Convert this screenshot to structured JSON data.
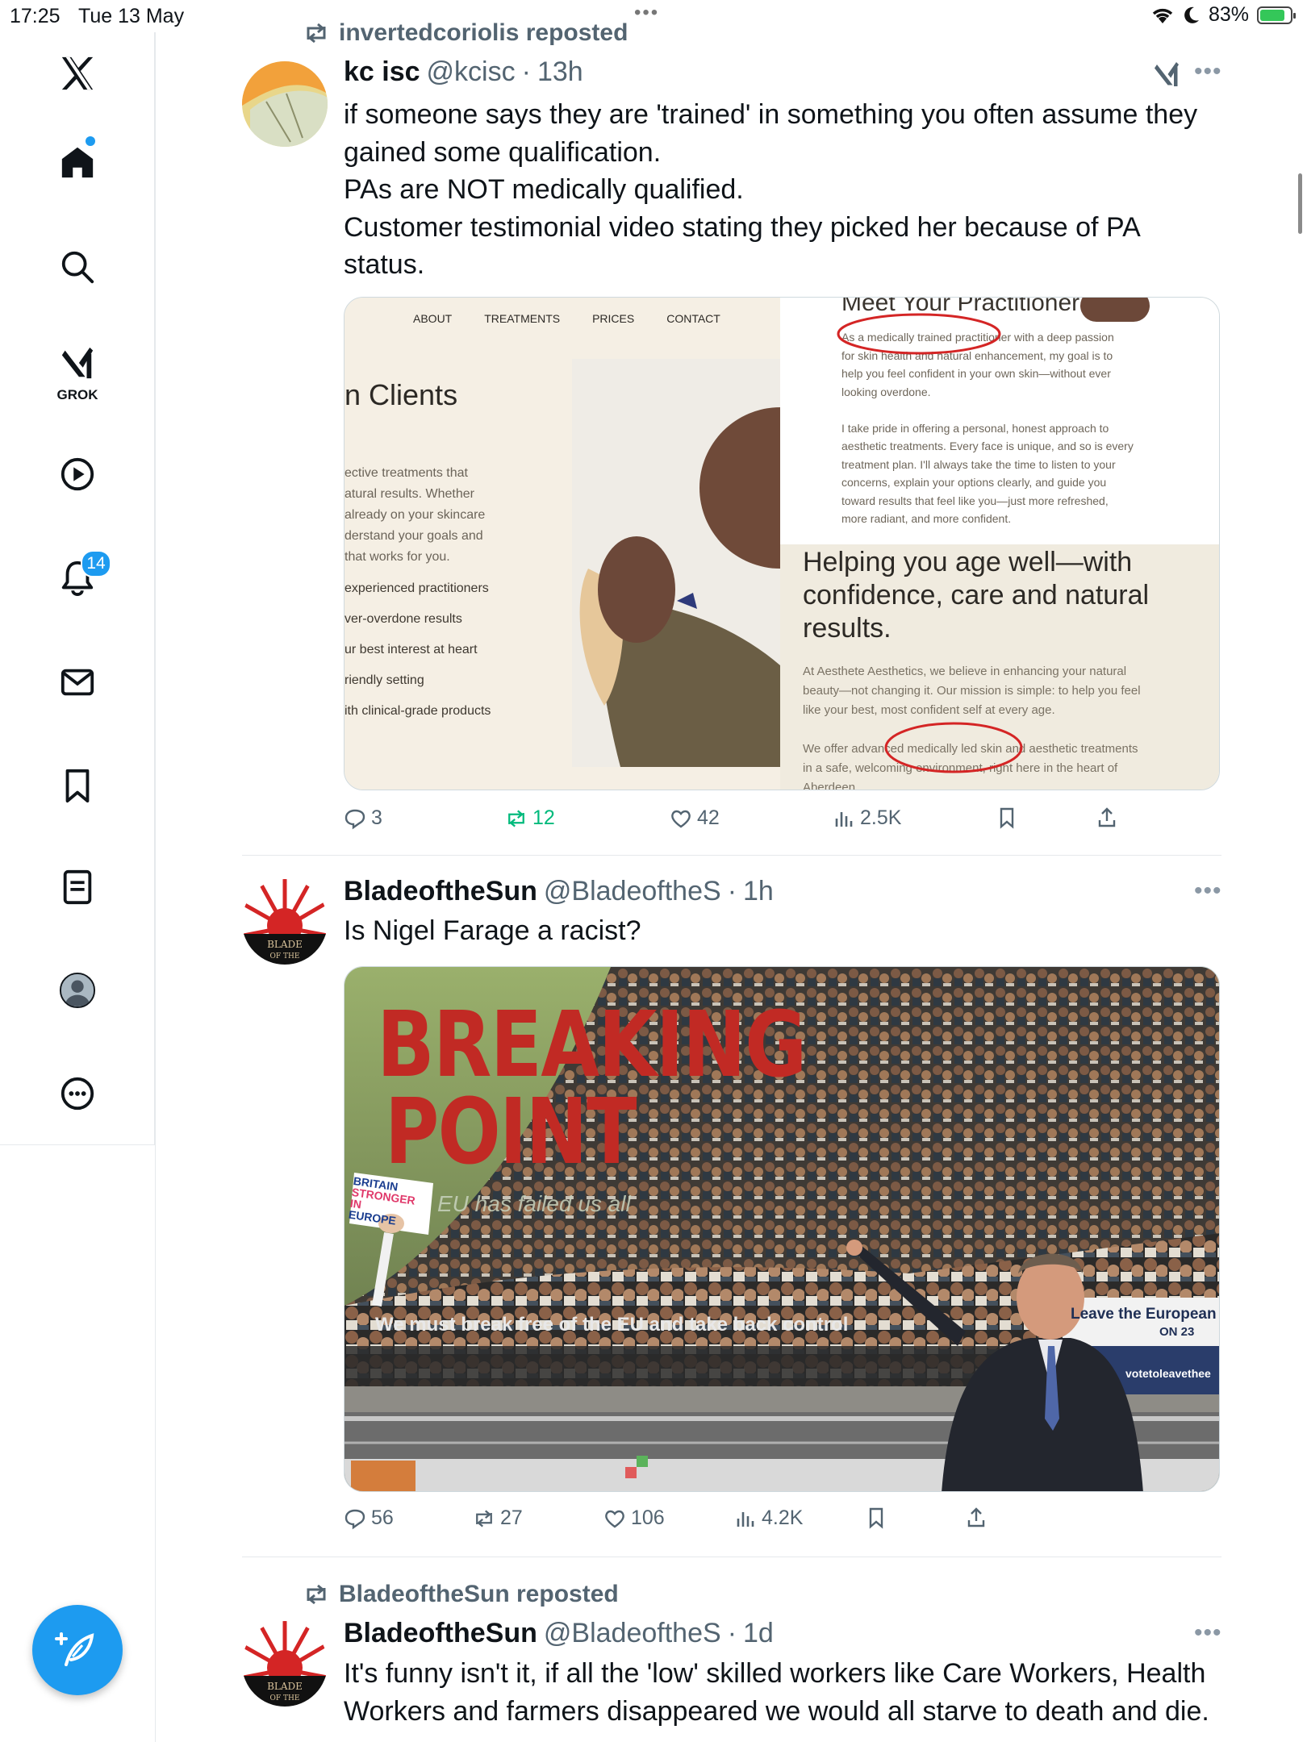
{
  "status_bar": {
    "time": "17:25",
    "date": "Tue 13 May",
    "battery": "83%"
  },
  "sidebar": {
    "items": [
      {
        "name": "x-logo",
        "label": ""
      },
      {
        "name": "home",
        "label": ""
      },
      {
        "name": "explore",
        "label": ""
      },
      {
        "name": "grok",
        "label": "GROK"
      },
      {
        "name": "video",
        "label": ""
      },
      {
        "name": "notifications",
        "label": "",
        "badge": "14"
      },
      {
        "name": "messages",
        "label": ""
      },
      {
        "name": "bookmarks",
        "label": ""
      },
      {
        "name": "lists",
        "label": ""
      },
      {
        "name": "profile",
        "label": ""
      },
      {
        "name": "more",
        "label": ""
      }
    ]
  },
  "colors": {
    "accent": "#1d9bf0",
    "muted": "#536471",
    "repost_green": "#00ba7c"
  },
  "tweets": [
    {
      "repost_by": "invertedcoriolis reposted",
      "display_name": "kc isc",
      "handle": "@kcisc",
      "time": "13h",
      "text": [
        "if someone says they are 'trained' in something you often assume they",
        "gained some qualification.",
        "PAs are NOT medically qualified.",
        "Customer testimonial  video stating they picked her because of PA",
        "status."
      ],
      "image": {
        "nav": [
          "ABOUT",
          "TREATMENTS",
          "PRICES",
          "CONTACT"
        ],
        "clients_title": "n Clients",
        "clients_para": [
          "ective treatments that",
          "atural results. Whether",
          "already on your skincare",
          "derstand your goals and",
          "that works for you."
        ],
        "clients_list": [
          "experienced practitioners",
          "ver-overdone results",
          "ur best interest at heart",
          "riendly setting",
          "ith clinical-grade products"
        ],
        "meet_title": "Meet Your Practitioner",
        "meet_para": [
          "As a medically trained practitioner with a deep passion",
          "for skin health and natural enhancement, my goal is to",
          "help you feel confident in your own skin—without ever",
          "looking overdone.",
          "",
          "I take pride in offering a personal, honest approach to",
          "aesthetic treatments. Every face is unique, and so is every",
          "treatment plan. I'll always take the time to listen to your",
          "concerns, explain your options clearly, and guide you",
          "toward results that feel like you—just more refreshed,",
          "more radiant, and more confident."
        ],
        "helping_title": "Helping you age well—with confidence, care and natural results.",
        "helping_para": [
          "At Aesthete Aesthetics, we believe in enhancing your natural",
          "beauty—not changing it. Our mission is simple: to help you feel",
          "like your best, most confident self at every age.",
          "",
          "We offer advanced medically led skin and aesthetic treatments",
          "in a safe, welcoming environment, right here in the heart of",
          "Aberdeen."
        ]
      },
      "replies": "3",
      "reposts": "12",
      "likes": "42",
      "views": "2.5K"
    },
    {
      "display_name": "BladeoftheSun",
      "handle": "@BladeoftheS",
      "time": "1h",
      "text": [
        "Is Nigel Farage a racist?"
      ],
      "image": {
        "headline_1": "BREAKING",
        "headline_2": "POINT",
        "sub": "EU has failed us all",
        "placard": [
          "BRITAIN",
          "STRONGER",
          "IN",
          "EUROPE"
        ],
        "caption": "We must break free of the EU and take back control",
        "sign": [
          "Leave the European",
          "ON 23",
          "votetoleavethee"
        ]
      },
      "replies": "56",
      "reposts": "27",
      "likes": "106",
      "views": "4.2K"
    },
    {
      "repost_by": "BladeoftheSun reposted",
      "display_name": "BladeoftheSun",
      "handle": "@BladeoftheS",
      "time": "1d",
      "text": [
        "It's funny isn't it, if all the 'low' skilled workers like Care Workers, Health",
        "Workers and farmers disappeared we would all starve to death and die."
      ]
    }
  ]
}
